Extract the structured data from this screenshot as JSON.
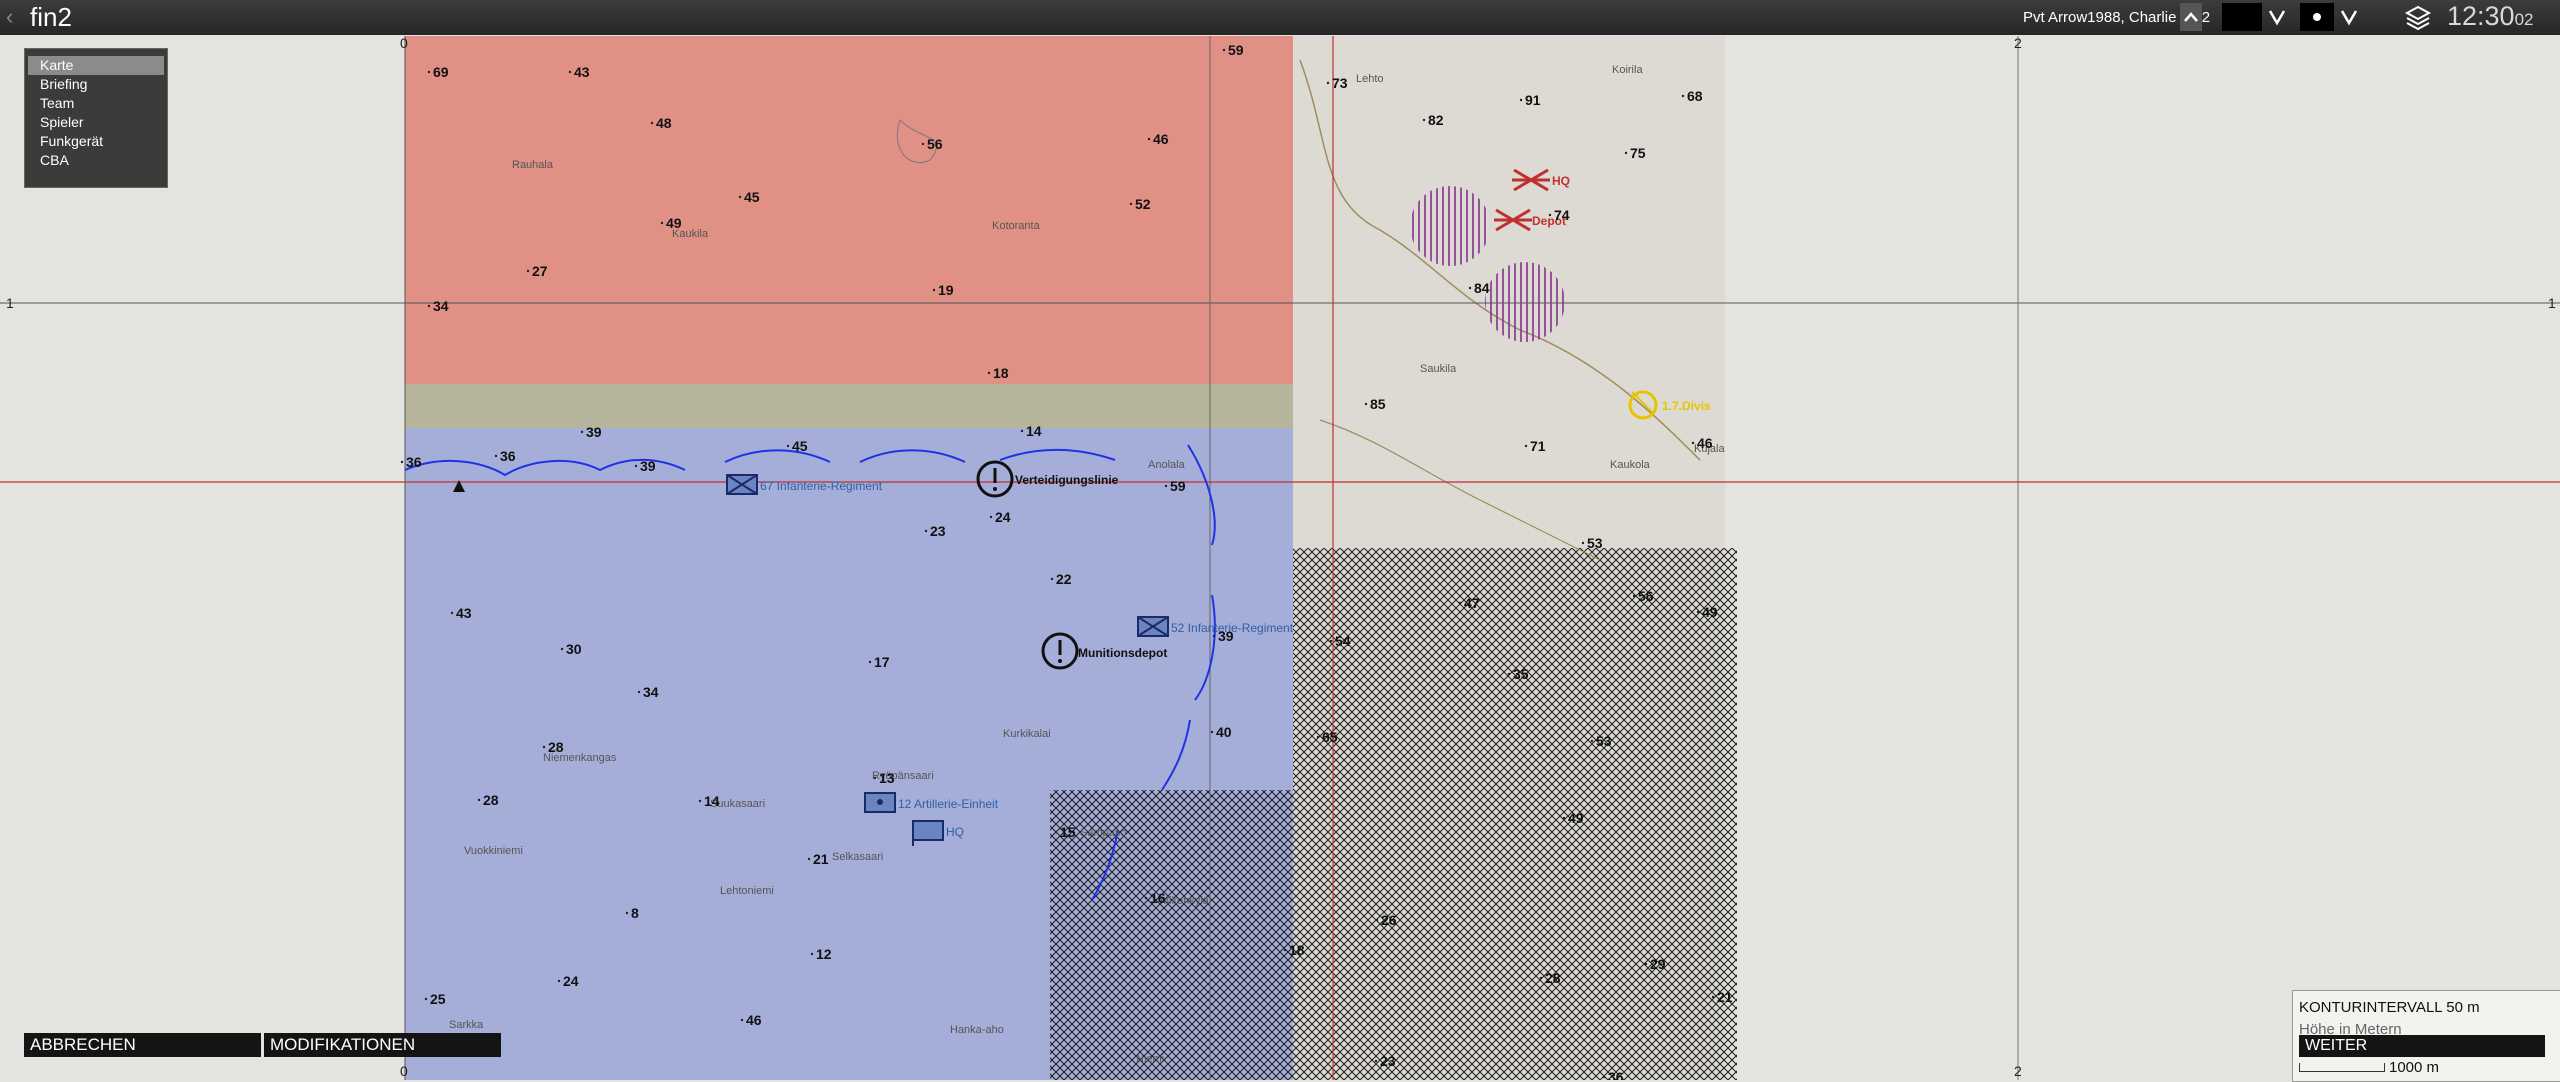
{
  "header": {
    "title": "fin2",
    "player": "Pvt Arrow1988, Charlie AT 2",
    "clock_hm": "12:30",
    "clock_s": "02",
    "icons": [
      "back-arrow-icon",
      "chevron-up-icon",
      "chevron-down-icon",
      "dot-icon",
      "layers-icon"
    ]
  },
  "menu": {
    "items": [
      "Karte",
      "Briefing",
      "Team",
      "Spieler",
      "Funkgerät",
      "CBA"
    ]
  },
  "buttons": {
    "cancel": "ABBRECHEN",
    "modifications": "MODIFIKATIONEN"
  },
  "legend": {
    "contour": "KONTURINTERVALL 50 m",
    "height": "Höhe in Metern",
    "next": "WEITER",
    "scale": "1000 m"
  },
  "grid_labels": {
    "top_left": "0",
    "top_right": "2",
    "left_mid": "1",
    "right_mid": "1",
    "bottom_left": "0",
    "bottom_right": "2"
  },
  "colors": {
    "enemy_zone": "#e0877c",
    "friendly_zone": "#9ea8d8",
    "front_line": "#1f32e6",
    "enemy_marker": "#c03030",
    "objective": "#e6c400",
    "restricted": "#9a4aa0"
  },
  "markers": {
    "hq_red": "HQ",
    "depot_red": "Depot",
    "objective_yellow": "1.7.Divis",
    "defense_line": "Verteidigungslinie",
    "ammo_depot": "Munitionsdepot",
    "unit_67": "67 Infanterie-Regiment",
    "unit_52": "52 Infanterie-Regiment",
    "unit_12": "12 Artillerie-Einheit",
    "hq_blue": "HQ"
  },
  "towns": [
    "Lehto",
    "Koirila",
    "Rauhala",
    "Kaukila",
    "Kotoranta",
    "Saukila",
    "Kaukola",
    "Anolala",
    "Niemenkangas",
    "Kurkikalai",
    "Ryöpänsaari",
    "Suukasaari",
    "Selkasaari",
    "Vuokkiniemi",
    "Lehtoniemi",
    "Sarkka",
    "Hanka-aho",
    "Sampaso",
    "Niemi",
    "Kujala",
    "Mikonkylä"
  ],
  "elevations": [
    "69",
    "43",
    "59",
    "73",
    "48",
    "56",
    "46",
    "82",
    "91",
    "68",
    "75",
    "45",
    "52",
    "74",
    "49",
    "27",
    "19",
    "84",
    "34",
    "18",
    "85",
    "71",
    "46",
    "39",
    "36",
    "14",
    "45",
    "36",
    "39",
    "59",
    "24",
    "23",
    "53",
    "22",
    "47",
    "56",
    "49",
    "43",
    "30",
    "39",
    "54",
    "17",
    "34",
    "35",
    "40",
    "65",
    "53",
    "28",
    "13",
    "28",
    "14",
    "49",
    "15",
    "21",
    "16",
    "26",
    "8",
    "18",
    "29",
    "12",
    "21",
    "25",
    "24",
    "46",
    "28",
    "23",
    "36"
  ]
}
